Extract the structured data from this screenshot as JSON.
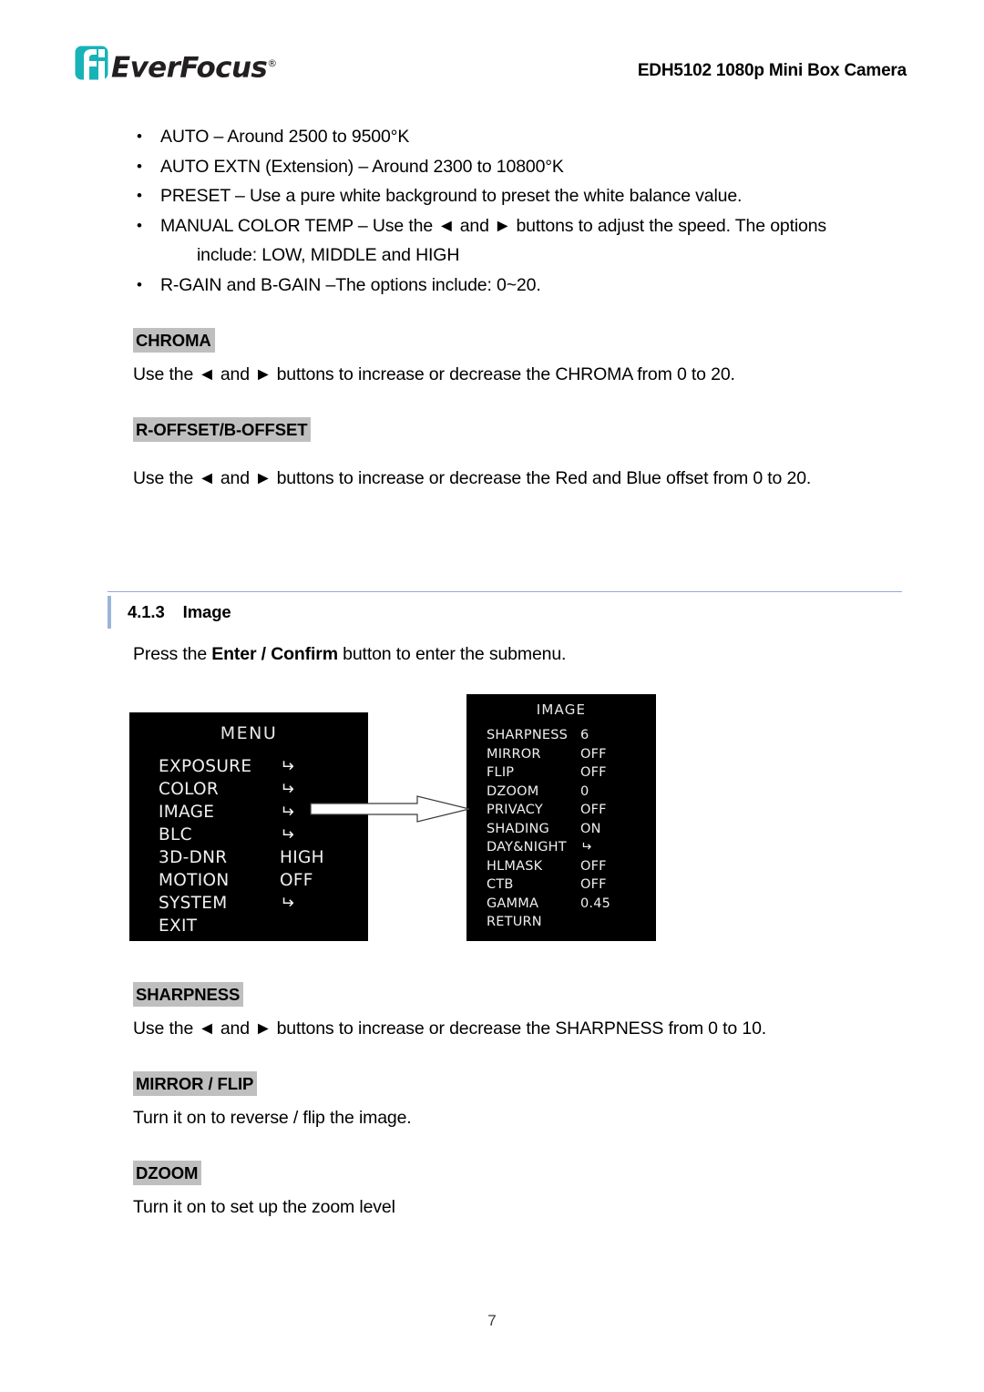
{
  "header": {
    "logo_text": "EverFocus",
    "logo_registered": "®",
    "logo_icon": "everfocus-f-mark",
    "title": "EDH5102 1080p Mini Box Camera",
    "brand_color": "#18b3b7"
  },
  "bullets": [
    {
      "text": "AUTO – Around 2500 to 9500°K"
    },
    {
      "text": "AUTO EXTN (Extension) – Around 2300 to 10800°K"
    },
    {
      "text": "PRESET – Use a pure white background to preset the white balance value."
    },
    {
      "text": "MANUAL COLOR TEMP – Use the ◄ and ► buttons to adjust the speed. The options",
      "continuation": "include: LOW, MIDDLE and HIGH"
    },
    {
      "text": "R-GAIN and B-GAIN –The options include: 0~20."
    }
  ],
  "sections": {
    "chroma": {
      "heading": "CHROMA",
      "body": "Use the ◄ and ► buttons to increase or decrease the CHROMA from 0 to 20."
    },
    "offset": {
      "heading": "R-OFFSET/B-OFFSET",
      "body": "Use the ◄ and ► buttons to increase or decrease the Red and Blue offset from 0 to 20."
    },
    "sharpness": {
      "heading": "SHARPNESS",
      "body": "Use the ◄ and ► buttons to increase or decrease the SHARPNESS from 0 to 10."
    },
    "mirror_flip": {
      "heading": "MIRROR / FLIP",
      "body": "Turn it on to reverse / flip the image."
    },
    "dzoom": {
      "heading": "DZOOM",
      "body": "Turn it on to set up the zoom level"
    }
  },
  "section_413": {
    "number": "4.1.3",
    "title": "Image",
    "intro_prefix": "Press the ",
    "intro_bold": "Enter / Confirm",
    "intro_suffix": " button to enter the submenu."
  },
  "figure": {
    "menu_panel": {
      "title": "MENU",
      "rows": [
        {
          "label": "EXPOSURE",
          "value": "↵"
        },
        {
          "label": "COLOR",
          "value": "↵"
        },
        {
          "label": "IMAGE",
          "value": "↵"
        },
        {
          "label": "BLC",
          "value": "↵"
        },
        {
          "label": "3D-DNR",
          "value": "HIGH"
        },
        {
          "label": "MOTION",
          "value": "OFF"
        },
        {
          "label": "SYSTEM",
          "value": "↵"
        },
        {
          "label": "EXIT",
          "value": ""
        }
      ]
    },
    "image_panel": {
      "title": "IMAGE",
      "rows": [
        {
          "label": "SHARPNESS",
          "value": "6"
        },
        {
          "label": "MIRROR",
          "value": "OFF"
        },
        {
          "label": "FLIP",
          "value": "OFF"
        },
        {
          "label": "DZOOM",
          "value": "0"
        },
        {
          "label": "PRIVACY",
          "value": "OFF"
        },
        {
          "label": "SHADING",
          "value": "ON"
        },
        {
          "label": "DAY&NIGHT",
          "value": "↵"
        },
        {
          "label": "HLMASK",
          "value": "OFF"
        },
        {
          "label": "CTB",
          "value": "OFF"
        },
        {
          "label": "GAMMA",
          "value": "0.45"
        },
        {
          "label": "RETURN",
          "value": ""
        }
      ]
    },
    "arrow_icon": "right-arrow-connector"
  },
  "footer": {
    "page_number": "7"
  }
}
